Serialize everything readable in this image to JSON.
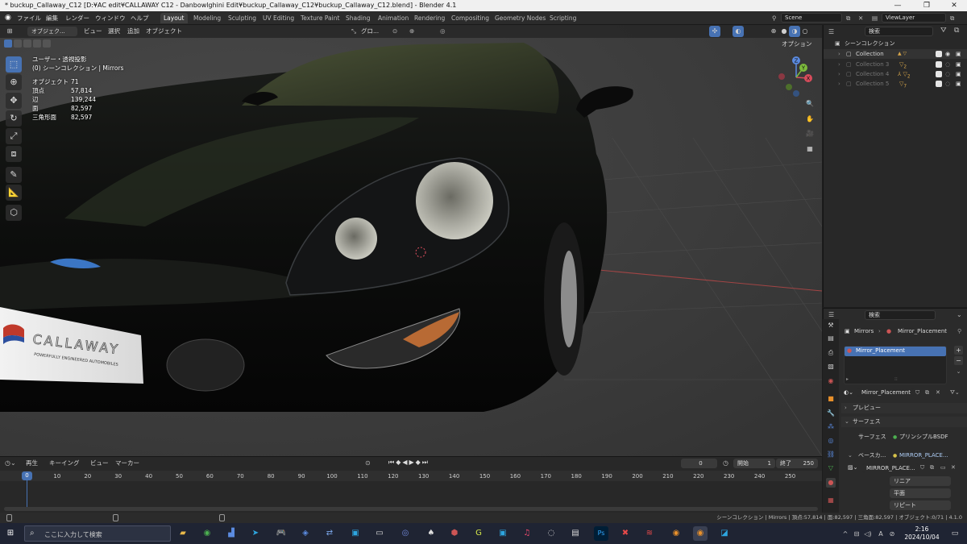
{
  "window": {
    "title": "* buckup_Callaway_C12 [D:¥AC edit¥CALLAWAY C12 - Danbowlghini Edit¥buckup_Callaway_C12¥buckup_Callaway_C12.blend] - Blender 4.1",
    "minimize": "—",
    "maximize": "❐",
    "close": "✕"
  },
  "menu": {
    "file": "ファイル",
    "edit": "編集",
    "render": "レンダー",
    "window": "ウィンドウ",
    "help": "ヘルプ"
  },
  "workspaces": [
    "Layout",
    "Modeling",
    "Sculpting",
    "UV Editing",
    "Texture Paint",
    "Shading",
    "Animation",
    "Rendering",
    "Compositing",
    "Geometry Nodes",
    "Scripting"
  ],
  "scene": {
    "name": "Scene",
    "view_layer": "ViewLayer"
  },
  "viewport_header": {
    "mode": "オブジェク...",
    "view": "ビュー",
    "select": "選択",
    "add": "追加",
    "object": "オブジェクト",
    "transform": "グロ...",
    "options": "オプション"
  },
  "overlay": {
    "view_name": "ユーザー・透視投影",
    "collection": "(0) シーンコレクション | Mirrors",
    "stats": [
      {
        "label": "オブジェクト",
        "value": "71"
      },
      {
        "label": "頂点",
        "value": "57,814"
      },
      {
        "label": "辺",
        "value": "139,244"
      },
      {
        "label": "面",
        "value": "82,597"
      },
      {
        "label": "三角形面",
        "value": "82,597"
      }
    ]
  },
  "gizmo": {
    "x": "X",
    "y": "Y",
    "z": "Z"
  },
  "plate": {
    "brand": "CALLAWAY",
    "slogan": "POWERFULLY ENGINEERED AUTOMOBILES"
  },
  "outliner": {
    "title": "シーンコレクション",
    "search_placeholder": "検索",
    "items": [
      {
        "name": "Collection",
        "count": "",
        "dim": false
      },
      {
        "name": "Collection 3",
        "count": "2",
        "dim": true
      },
      {
        "name": "Collection 4",
        "count": "2",
        "dim": true
      },
      {
        "name": "Collection 5",
        "count": "7",
        "dim": true
      }
    ]
  },
  "properties": {
    "search_placeholder": "検索",
    "breadcrumb_object": "Mirrors",
    "breadcrumb_material": "Mirror_Placement",
    "slot": "Mirror_Placement",
    "material_name": "Mirror_Placement",
    "preview": "プレビュー",
    "surface_panel": "サーフェス",
    "surface_label": "サーフェス",
    "surface_value": "プリンシプルBSDF",
    "base_color_label": "ベースカ...",
    "base_color_value": "MIRROR_PLACE...",
    "image_name": "MIRROR_PLACE...",
    "interp": "リニア",
    "projection": "平面",
    "extension": "リピート"
  },
  "timeline": {
    "playback": "再生",
    "keying": "キーイング",
    "view": "ビュー",
    "marker": "マーカー",
    "current_frame": "0",
    "start_label": "開始",
    "start": "1",
    "end_label": "終了",
    "end": "250",
    "ticks": [
      "0",
      "10",
      "20",
      "30",
      "40",
      "50",
      "60",
      "70",
      "80",
      "90",
      "100",
      "110",
      "120",
      "130",
      "140",
      "150",
      "160",
      "170",
      "180",
      "190",
      "200",
      "210",
      "220",
      "230",
      "240",
      "250"
    ]
  },
  "status": {
    "text": "シーンコレクション | Mirrors | 頂点:57,814 | 面:82,597 | 三角面:82,597 | オブジェクト:0/71 | 4.1.0"
  },
  "taskbar": {
    "search_placeholder": "ここに入力して検索",
    "time": "2:16",
    "date": "2024/10/04",
    "ime": "A"
  }
}
